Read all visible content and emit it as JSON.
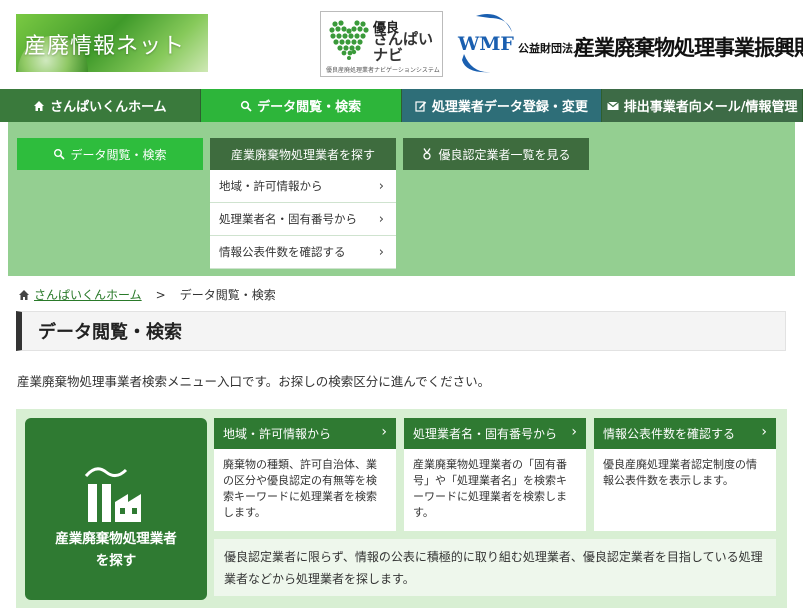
{
  "header": {
    "site_logo_text": "産廃情報ネット",
    "navi_logo": {
      "line1": "優良",
      "line2": "さんぱい",
      "line3": "ナビ",
      "sub": "優良産廃処理業者ナビゲーションシステム"
    },
    "foundation": {
      "mark": "WMF",
      "prefix": "公益財団法人",
      "name": "産業廃棄物処理事業振興財団"
    }
  },
  "mainnav": [
    {
      "label": "さんぱいくんホーム",
      "icon": "home-icon"
    },
    {
      "label": "データ閲覧・検索",
      "icon": "search-icon",
      "active": true
    },
    {
      "label": "処理業者データ登録・変更",
      "icon": "edit-icon"
    },
    {
      "label": "排出事業者向メール/情報管理",
      "icon": "mail-icon"
    }
  ],
  "submenu": {
    "buttons": [
      "データ閲覧・検索",
      "産業廃棄物処理業者を探す",
      "優良認定業者一覧を見る"
    ],
    "dropdown": [
      "地域・許可情報から",
      "処理業者名・固有番号から",
      "情報公表件数を確認する"
    ]
  },
  "breadcrumb": {
    "home": "さんぱいくんホーム",
    "separator": ">",
    "current": "データ閲覧・検索"
  },
  "page": {
    "title": "データ閲覧・検索",
    "intro": "産業廃棄物処理事業者検索メニュー入口です。お探しの検索区分に進んでください。"
  },
  "category": {
    "main_label_1": "産業廃棄物処理業者",
    "main_label_2": "を探す",
    "options": [
      {
        "title": "地域・許可情報から",
        "desc": "廃棄物の種類、許可自治体、業の区分や優良認定の有無等を検索キーワードに処理業者を検索します。"
      },
      {
        "title": "処理業者名・固有番号から",
        "desc": "産業廃棄物処理業者の「固有番号」や「処理業者名」を検索キーワードに処理業者を検索します。"
      },
      {
        "title": "情報公表件数を確認する",
        "desc": "優良産廃処理業者認定制度の情報公表件数を表示します。"
      }
    ],
    "note": "優良認定業者に限らず、情報の公表に積極的に取り組む処理業者、優良認定業者を目指している処理業者などから処理業者を探します。"
  },
  "colors": {
    "nav_green": "#3a7a3c",
    "active_green": "#2db53a",
    "panel_green": "#94cf91",
    "card_green": "#2f7a32"
  }
}
